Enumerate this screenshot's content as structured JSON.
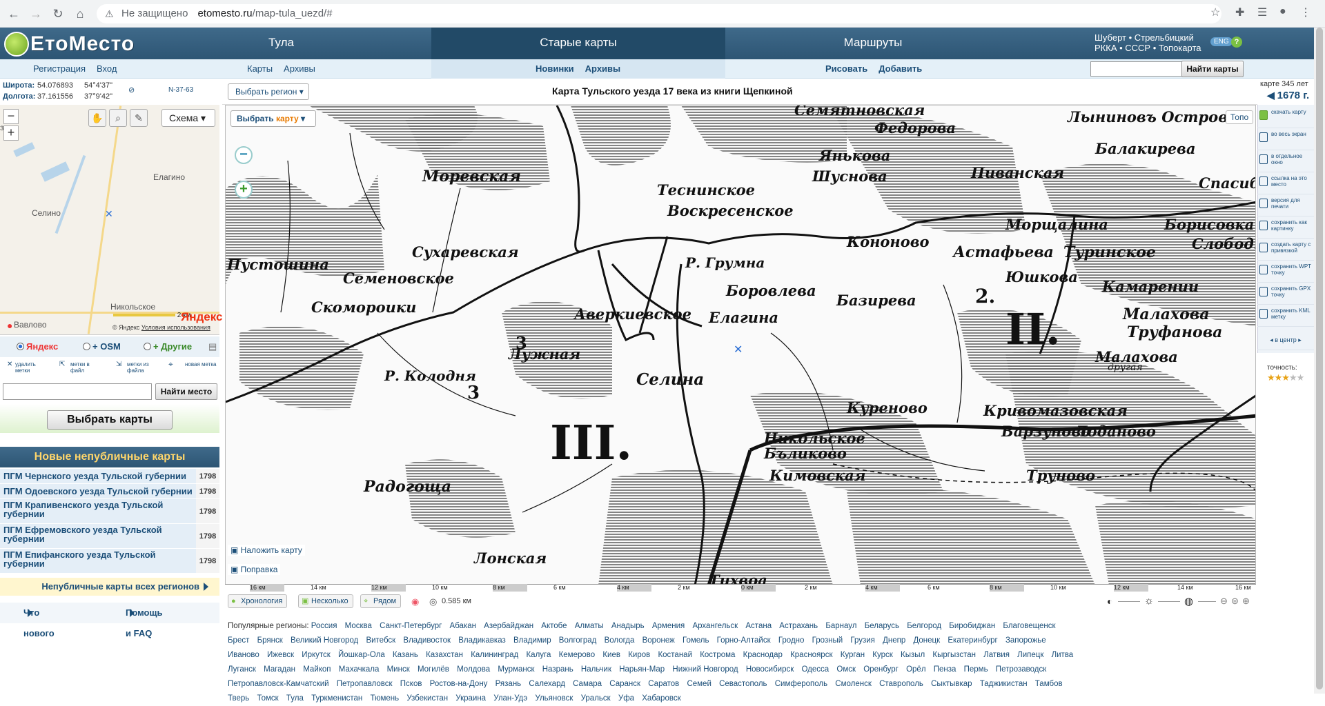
{
  "browser": {
    "not_secure": "Не защищено",
    "host": "etomesto.ru",
    "path": "/map-tula_uezd/#"
  },
  "site": {
    "logo": "ЕтоМесто",
    "menu": [
      "Тула",
      "Старые карты",
      "Маршруты"
    ],
    "right_links_line1": "Шуберт • Стрельбицкий",
    "right_links_line2": "РККА • СССР • Топокарта",
    "lang": "ENG",
    "help": "?",
    "sub_left": [
      "Регистрация",
      "Вход"
    ],
    "sub_tula": [
      "Карты",
      "Архивы"
    ],
    "sub_old": [
      "Новинки",
      "Архивы"
    ],
    "sub_routes": [
      "Рисовать",
      "Добавить"
    ],
    "find_maps": "Найти карты"
  },
  "coords": {
    "lat_label": "Широта:",
    "lat": "54.076893",
    "lat_dms": "54°4'37\"",
    "lon_label": "Долгота:",
    "lon": "37.161556",
    "lon_dms": "37°9'42\"",
    "sheet": "N-37-63"
  },
  "minimap": {
    "schema": "Схема ▾",
    "labels": [
      "Елагино",
      "Селино",
      "Никольское",
      "Вавлово",
      "зкое"
    ],
    "scale": "2 км",
    "yandex": "Яндекс",
    "copyright": "© Яндекс",
    "terms": "Условия использования"
  },
  "layers": {
    "yandex": "Яндекс",
    "osm": "+ OSM",
    "other": "+ Другие"
  },
  "marks": [
    "удалить метки",
    "метки в файл",
    "метки из файла",
    "новая метка"
  ],
  "find_place": "Найти место",
  "choose_maps": "Выбрать карты",
  "new_maps": {
    "title": "Новые непубличные карты",
    "items": [
      {
        "title": "ПГМ Чернского уезда Тульской губернии",
        "year": "1798"
      },
      {
        "title": "ПГМ Одоевского уезда Тульской губернии",
        "year": "1798"
      },
      {
        "title": "ПГМ Крапивенского уезда Тульской губернии",
        "year": "1798"
      },
      {
        "title": "ПГМ Ефремовского уезда Тульской губернии",
        "year": "1798"
      },
      {
        "title": "ПГМ Епифанского уезда Тульской губернии",
        "year": "1798"
      }
    ],
    "all_regions": "Непубличные карты всех регионов"
  },
  "bottom_links": [
    "Что нового",
    "Помощь и FAQ"
  ],
  "map": {
    "region_select": "Выбрать регион ▾",
    "title": "Карта Тульского уезда 17 века из книги Щепкиной",
    "age": "карте 345 лет",
    "year": "1678 г.",
    "choose_map_a": "Выбрать",
    "choose_map_b": "карту",
    "topo": "Топо",
    "overlay": "Наложить карту",
    "correction": "Поправка",
    "labels": [
      "Моревская",
      "Теснинское",
      "Воскресенское",
      "Шуснова",
      "Пиванская",
      "Балакирева",
      "Спасибогская",
      "Янькова",
      "Федорова",
      "Сухаревская",
      "Пустошина",
      "Семеновское",
      "Кононово",
      "Морщалина",
      "Борисовка",
      "Слободка",
      "Астафьева",
      "Туринское",
      "Юшкова",
      "Камарении",
      "Скомороики",
      "Боровлева",
      "Базирева",
      "Елагина",
      "Аверкиевское",
      "Малахова",
      "Труфанова",
      "Лужная",
      "Селина",
      "Малахова",
      "другая",
      "Куреново",
      "Кривомазовская",
      "Варзуново",
      "Лоданово",
      "Радогоща",
      "Никольское",
      "Бъликово",
      "Кимовская",
      "Труново",
      "Лонская",
      "Тихвоа",
      "Р. Колодня",
      "Р. Грумна",
      "Семятновская",
      "Лыниновъ Островъ"
    ],
    "romans": [
      "III.",
      "II.",
      "2.",
      "3",
      "3"
    ],
    "scale": [
      "16 км",
      "14 км",
      "12 км",
      "10 км",
      "8 км",
      "6 км",
      "4 км",
      "2 км",
      "0 км",
      "2 км",
      "4 км",
      "6 км",
      "8 км",
      "10 км",
      "12 км",
      "14 км",
      "16 км"
    ]
  },
  "map_tools": {
    "chronology": "Хронология",
    "several": "Несколько",
    "near": "Рядом",
    "opacity": "0.585 км"
  },
  "sidebar_right": [
    "скачать карту",
    "во весь экран",
    "в отдельное окно",
    "ссылка на это место",
    "версия для печати",
    "сохранить как картинку",
    "создать карту с привязкой",
    "сохранить WPT точку",
    "сохранить GPX точку",
    "сохранить KML метку"
  ],
  "center": "в центр",
  "accuracy": "точность:",
  "regions": {
    "label": "Популярные регионы:",
    "items": [
      "Россия",
      "Москва",
      "Санкт-Петербург",
      "Абакан",
      "Азербайджан",
      "Актобе",
      "Алматы",
      "Анадырь",
      "Армения",
      "Архангельск",
      "Астана",
      "Астрахань",
      "Барнаул",
      "Беларусь",
      "Белгород",
      "Биробиджан",
      "Благовещенск",
      "Брест",
      "Брянск",
      "Великий Новгород",
      "Витебск",
      "Владивосток",
      "Владикавказ",
      "Владимир",
      "Волгоград",
      "Вологда",
      "Воронеж",
      "Гомель",
      "Горно-Алтайск",
      "Гродно",
      "Грозный",
      "Грузия",
      "Днепр",
      "Донецк",
      "Екатеринбург",
      "Запорожье",
      "Иваново",
      "Ижевск",
      "Иркутск",
      "Йошкар-Ола",
      "Казань",
      "Казахстан",
      "Калининград",
      "Калуга",
      "Кемерово",
      "Киев",
      "Киров",
      "Костанай",
      "Кострома",
      "Краснодар",
      "Красноярск",
      "Курган",
      "Курск",
      "Кызыл",
      "Кыргызстан",
      "Латвия",
      "Липецк",
      "Литва",
      "Луганск",
      "Магадан",
      "Майкоп",
      "Махачкала",
      "Минск",
      "Могилёв",
      "Молдова",
      "Мурманск",
      "Назрань",
      "Нальчик",
      "Нарьян-Мар",
      "Нижний Новгород",
      "Новосибирск",
      "Одесса",
      "Омск",
      "Оренбург",
      "Орёл",
      "Пенза",
      "Пермь",
      "Петрозаводск",
      "Петропавловск-Камчатский",
      "Петропавловск",
      "Псков",
      "Ростов-на-Дону",
      "Рязань",
      "Салехард",
      "Самара",
      "Саранск",
      "Саратов",
      "Семей",
      "Севастополь",
      "Симферополь",
      "Смоленск",
      "Ставрополь",
      "Сыктывкар",
      "Таджикистан",
      "Тамбов",
      "Тверь",
      "Томск",
      "Тула",
      "Туркменистан",
      "Тюмень",
      "Узбекистан",
      "Украина",
      "Улан-Удэ",
      "Ульяновск",
      "Уральск",
      "Уфа",
      "Хабаровск"
    ]
  }
}
